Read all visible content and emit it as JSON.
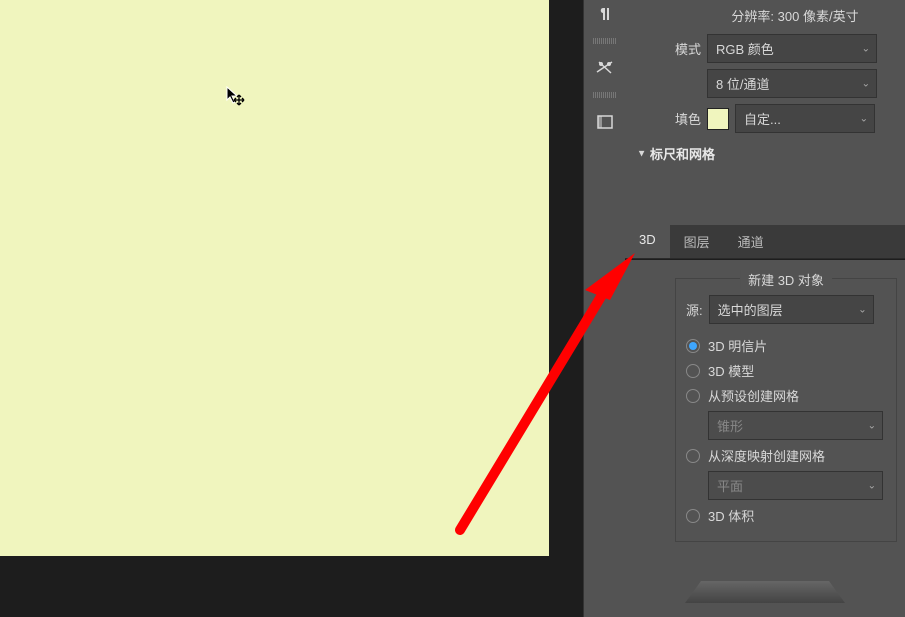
{
  "properties": {
    "resolution_label": "分辨率:",
    "resolution_value": "300 像素/英寸",
    "mode_label": "模式",
    "mode_value": "RGB 颜色",
    "bit_depth": "8 位/通道",
    "fill_label": "填色",
    "fill_value": "自定...",
    "fill_swatch": "#f0f5be",
    "section_ruler_grid": "标尺和网格"
  },
  "tabs": {
    "tab_3d": "3D",
    "tab_layers": "图层",
    "tab_channels": "通道"
  },
  "panel3d": {
    "group_title": "新建 3D 对象",
    "source_label": "源:",
    "source_value": "选中的图层",
    "options": {
      "postcard": "3D 明信片",
      "model": "3D 模型",
      "preset_mesh": "从预设创建网格",
      "preset_mesh_value": "锥形",
      "depth_mesh": "从深度映射创建网格",
      "depth_mesh_value": "平面",
      "volume": "3D 体积"
    }
  }
}
